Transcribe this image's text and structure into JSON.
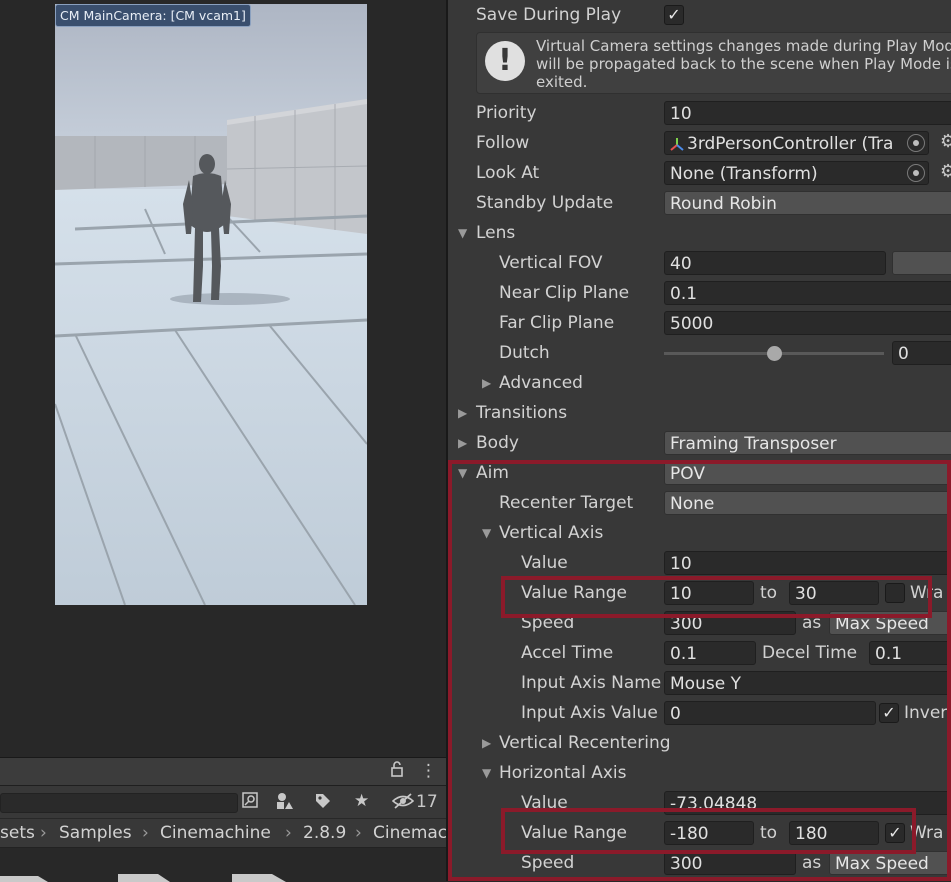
{
  "game_view": {
    "label": "CM MainCamera: [CM vcam1]"
  },
  "project": {
    "filter_count": "17",
    "breadcrumb": [
      "sets",
      "Samples",
      "Cinemachine",
      "2.8.9",
      "Cinemac"
    ],
    "sep": "›"
  },
  "inspector": {
    "save_during_play": {
      "label": "Save During Play",
      "checked": true,
      "check": "✓"
    },
    "help": {
      "icon": "!",
      "text": "Virtual Camera settings changes made during Play Mode will be propagated back to the scene when Play Mode is exited."
    },
    "priority": {
      "label": "Priority",
      "value": "10"
    },
    "follow": {
      "label": "Follow",
      "value": "3rdPersonController (Tra"
    },
    "look_at": {
      "label": "Look At",
      "value": "None (Transform)"
    },
    "standby_update": {
      "label": "Standby Update",
      "value": "Round Robin"
    },
    "lens": {
      "label": "Lens",
      "vertical_fov": {
        "label": "Vertical FOV",
        "value": "40"
      },
      "near_clip": {
        "label": "Near Clip Plane",
        "value": "0.1"
      },
      "far_clip": {
        "label": "Far Clip Plane",
        "value": "5000"
      },
      "dutch": {
        "label": "Dutch",
        "value": "0"
      },
      "advanced": {
        "label": "Advanced"
      }
    },
    "transitions": {
      "label": "Transitions"
    },
    "body": {
      "label": "Body",
      "value": "Framing Transposer"
    },
    "aim": {
      "label": "Aim",
      "value": "POV",
      "recenter_target": {
        "label": "Recenter Target",
        "value": "None"
      },
      "vertical_axis": {
        "label": "Vertical Axis",
        "value": {
          "label": "Value",
          "value": "10"
        },
        "value_range": {
          "label": "Value Range",
          "min": "10",
          "to": "to",
          "max": "30",
          "wrap_checked": false,
          "wrap": "Wra"
        },
        "speed": {
          "label": "Speed",
          "value": "300",
          "as": "as",
          "mode": "Max Speed"
        },
        "accel_time": {
          "label": "Accel Time",
          "value": "0.1"
        },
        "decel_time": {
          "label": "Decel Time",
          "value": "0.1"
        },
        "input_axis_name": {
          "label": "Input Axis Name",
          "value": "Mouse Y"
        },
        "input_axis_value": {
          "label": "Input Axis Value",
          "value": "0",
          "invert_checked": true,
          "invert": "Inver",
          "check": "✓"
        }
      },
      "vertical_recentering": {
        "label": "Vertical Recentering"
      },
      "horizontal_axis": {
        "label": "Horizontal Axis",
        "value": {
          "label": "Value",
          "value": "-73.04848"
        },
        "value_range": {
          "label": "Value Range",
          "min": "-180",
          "to": "to",
          "max": "180",
          "wrap_checked": true,
          "wrap": "Wra",
          "check": "✓"
        },
        "speed": {
          "label": "Speed",
          "value": "300",
          "as": "as",
          "mode": "Max Speed"
        }
      }
    }
  },
  "colors": {
    "highlight": "#8b1a2a",
    "panel": "#383838",
    "field": "#2a2a2a",
    "camera_label_bg": "#3a4f6e"
  }
}
